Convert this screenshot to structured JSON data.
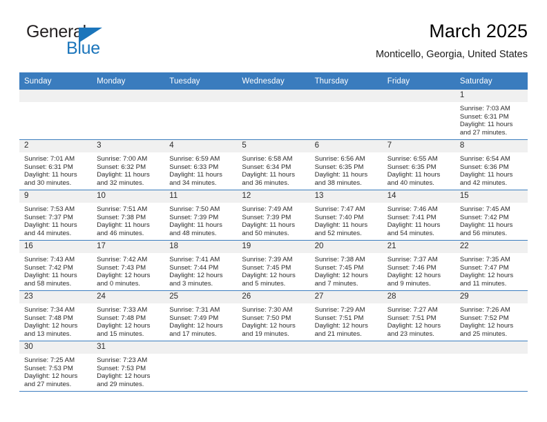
{
  "brand": {
    "word1": "General",
    "word2": "Blue",
    "accent_color": "#1b75bb"
  },
  "header": {
    "title": "March 2025",
    "location": "Monticello, Georgia, United States"
  },
  "calendar": {
    "header_color": "#3a7cbe",
    "weekday_headers": [
      "Sunday",
      "Monday",
      "Tuesday",
      "Wednesday",
      "Thursday",
      "Friday",
      "Saturday"
    ],
    "weeks": [
      [
        null,
        null,
        null,
        null,
        null,
        null,
        {
          "day": "1",
          "sunrise": "Sunrise: 7:03 AM",
          "sunset": "Sunset: 6:31 PM",
          "daylight": "Daylight: 11 hours and 27 minutes."
        }
      ],
      [
        {
          "day": "2",
          "sunrise": "Sunrise: 7:01 AM",
          "sunset": "Sunset: 6:31 PM",
          "daylight": "Daylight: 11 hours and 30 minutes."
        },
        {
          "day": "3",
          "sunrise": "Sunrise: 7:00 AM",
          "sunset": "Sunset: 6:32 PM",
          "daylight": "Daylight: 11 hours and 32 minutes."
        },
        {
          "day": "4",
          "sunrise": "Sunrise: 6:59 AM",
          "sunset": "Sunset: 6:33 PM",
          "daylight": "Daylight: 11 hours and 34 minutes."
        },
        {
          "day": "5",
          "sunrise": "Sunrise: 6:58 AM",
          "sunset": "Sunset: 6:34 PM",
          "daylight": "Daylight: 11 hours and 36 minutes."
        },
        {
          "day": "6",
          "sunrise": "Sunrise: 6:56 AM",
          "sunset": "Sunset: 6:35 PM",
          "daylight": "Daylight: 11 hours and 38 minutes."
        },
        {
          "day": "7",
          "sunrise": "Sunrise: 6:55 AM",
          "sunset": "Sunset: 6:35 PM",
          "daylight": "Daylight: 11 hours and 40 minutes."
        },
        {
          "day": "8",
          "sunrise": "Sunrise: 6:54 AM",
          "sunset": "Sunset: 6:36 PM",
          "daylight": "Daylight: 11 hours and 42 minutes."
        }
      ],
      [
        {
          "day": "9",
          "sunrise": "Sunrise: 7:53 AM",
          "sunset": "Sunset: 7:37 PM",
          "daylight": "Daylight: 11 hours and 44 minutes."
        },
        {
          "day": "10",
          "sunrise": "Sunrise: 7:51 AM",
          "sunset": "Sunset: 7:38 PM",
          "daylight": "Daylight: 11 hours and 46 minutes."
        },
        {
          "day": "11",
          "sunrise": "Sunrise: 7:50 AM",
          "sunset": "Sunset: 7:39 PM",
          "daylight": "Daylight: 11 hours and 48 minutes."
        },
        {
          "day": "12",
          "sunrise": "Sunrise: 7:49 AM",
          "sunset": "Sunset: 7:39 PM",
          "daylight": "Daylight: 11 hours and 50 minutes."
        },
        {
          "day": "13",
          "sunrise": "Sunrise: 7:47 AM",
          "sunset": "Sunset: 7:40 PM",
          "daylight": "Daylight: 11 hours and 52 minutes."
        },
        {
          "day": "14",
          "sunrise": "Sunrise: 7:46 AM",
          "sunset": "Sunset: 7:41 PM",
          "daylight": "Daylight: 11 hours and 54 minutes."
        },
        {
          "day": "15",
          "sunrise": "Sunrise: 7:45 AM",
          "sunset": "Sunset: 7:42 PM",
          "daylight": "Daylight: 11 hours and 56 minutes."
        }
      ],
      [
        {
          "day": "16",
          "sunrise": "Sunrise: 7:43 AM",
          "sunset": "Sunset: 7:42 PM",
          "daylight": "Daylight: 11 hours and 58 minutes."
        },
        {
          "day": "17",
          "sunrise": "Sunrise: 7:42 AM",
          "sunset": "Sunset: 7:43 PM",
          "daylight": "Daylight: 12 hours and 0 minutes."
        },
        {
          "day": "18",
          "sunrise": "Sunrise: 7:41 AM",
          "sunset": "Sunset: 7:44 PM",
          "daylight": "Daylight: 12 hours and 3 minutes."
        },
        {
          "day": "19",
          "sunrise": "Sunrise: 7:39 AM",
          "sunset": "Sunset: 7:45 PM",
          "daylight": "Daylight: 12 hours and 5 minutes."
        },
        {
          "day": "20",
          "sunrise": "Sunrise: 7:38 AM",
          "sunset": "Sunset: 7:45 PM",
          "daylight": "Daylight: 12 hours and 7 minutes."
        },
        {
          "day": "21",
          "sunrise": "Sunrise: 7:37 AM",
          "sunset": "Sunset: 7:46 PM",
          "daylight": "Daylight: 12 hours and 9 minutes."
        },
        {
          "day": "22",
          "sunrise": "Sunrise: 7:35 AM",
          "sunset": "Sunset: 7:47 PM",
          "daylight": "Daylight: 12 hours and 11 minutes."
        }
      ],
      [
        {
          "day": "23",
          "sunrise": "Sunrise: 7:34 AM",
          "sunset": "Sunset: 7:48 PM",
          "daylight": "Daylight: 12 hours and 13 minutes."
        },
        {
          "day": "24",
          "sunrise": "Sunrise: 7:33 AM",
          "sunset": "Sunset: 7:48 PM",
          "daylight": "Daylight: 12 hours and 15 minutes."
        },
        {
          "day": "25",
          "sunrise": "Sunrise: 7:31 AM",
          "sunset": "Sunset: 7:49 PM",
          "daylight": "Daylight: 12 hours and 17 minutes."
        },
        {
          "day": "26",
          "sunrise": "Sunrise: 7:30 AM",
          "sunset": "Sunset: 7:50 PM",
          "daylight": "Daylight: 12 hours and 19 minutes."
        },
        {
          "day": "27",
          "sunrise": "Sunrise: 7:29 AM",
          "sunset": "Sunset: 7:51 PM",
          "daylight": "Daylight: 12 hours and 21 minutes."
        },
        {
          "day": "28",
          "sunrise": "Sunrise: 7:27 AM",
          "sunset": "Sunset: 7:51 PM",
          "daylight": "Daylight: 12 hours and 23 minutes."
        },
        {
          "day": "29",
          "sunrise": "Sunrise: 7:26 AM",
          "sunset": "Sunset: 7:52 PM",
          "daylight": "Daylight: 12 hours and 25 minutes."
        }
      ],
      [
        {
          "day": "30",
          "sunrise": "Sunrise: 7:25 AM",
          "sunset": "Sunset: 7:53 PM",
          "daylight": "Daylight: 12 hours and 27 minutes."
        },
        {
          "day": "31",
          "sunrise": "Sunrise: 7:23 AM",
          "sunset": "Sunset: 7:53 PM",
          "daylight": "Daylight: 12 hours and 29 minutes."
        },
        null,
        null,
        null,
        null,
        null
      ]
    ]
  }
}
